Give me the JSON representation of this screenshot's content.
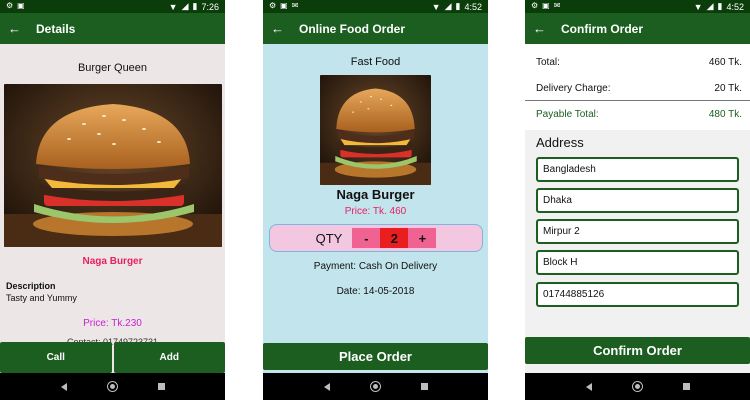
{
  "screens": [
    {
      "status_time": "7:26",
      "app_title": "Details",
      "restaurant": "Burger Queen",
      "item_name": "Naga Burger",
      "description_heading": "Description",
      "description": "Tasty and Yummy",
      "price": "Price: Tk.230",
      "contact": "Contact: 01749723731",
      "call_label": "Call",
      "add_label": "Add"
    },
    {
      "status_time": "4:52",
      "app_title": "Online Food Order",
      "category": "Fast Food",
      "item_name": "Naga Burger",
      "price": "Price: Tk. 460",
      "qty_label": "QTY",
      "qty_minus": "-",
      "qty_value": "2",
      "qty_plus": "+",
      "payment": "Payment: Cash On Delivery",
      "date": "Date: 14-05-2018",
      "place_order_label": "Place Order"
    },
    {
      "status_time": "4:52",
      "app_title": "Confirm Order",
      "total_label": "Total:",
      "total_value": "460 Tk.",
      "delivery_label": "Delivery Charge:",
      "delivery_value": "20 Tk.",
      "payable_label": "Payable Total:",
      "payable_value": "480 Tk.",
      "address_heading": "Address",
      "address_fields": [
        "Bangladesh",
        "Dhaka",
        "Mirpur 2",
        "Block H",
        "01744885126"
      ],
      "confirm_label": "Confirm Order"
    }
  ],
  "colors": {
    "appbar": "#1b5e20",
    "statusbar": "#0b3d0b",
    "price_pink": "#e91e63",
    "price_purple": "#c71fd0"
  },
  "icons": [
    "back-arrow-icon",
    "wifi-icon",
    "signal-icon",
    "battery-icon",
    "nav-back-icon",
    "nav-home-icon",
    "nav-recent-icon"
  ]
}
